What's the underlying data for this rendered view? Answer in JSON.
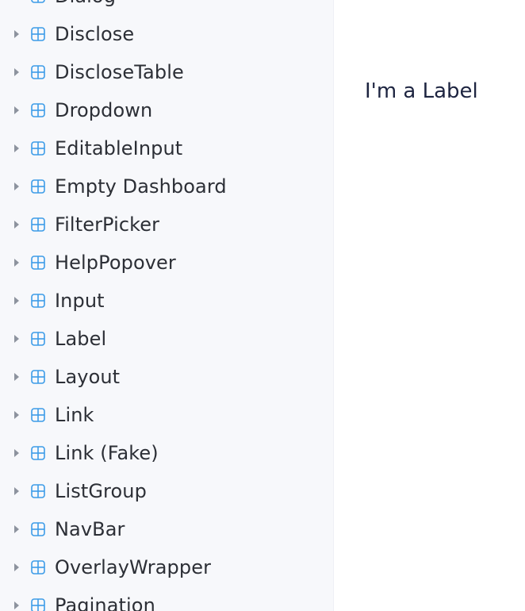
{
  "sidebar": {
    "items": [
      {
        "label": "Dialog"
      },
      {
        "label": "Disclose"
      },
      {
        "label": "DiscloseTable"
      },
      {
        "label": "Dropdown"
      },
      {
        "label": "EditableInput"
      },
      {
        "label": "Empty Dashboard"
      },
      {
        "label": "FilterPicker"
      },
      {
        "label": "HelpPopover"
      },
      {
        "label": "Input"
      },
      {
        "label": "Label"
      },
      {
        "label": "Layout"
      },
      {
        "label": "Link"
      },
      {
        "label": "Link (Fake)"
      },
      {
        "label": "ListGroup"
      },
      {
        "label": "NavBar"
      },
      {
        "label": "OverlayWrapper"
      },
      {
        "label": "Pagination"
      }
    ],
    "icons": {
      "expand": "caret-right-icon",
      "component": "component-grid-icon"
    }
  },
  "main": {
    "preview_text": "I'm a Label"
  },
  "colors": {
    "sidebar_bg": "#f7f8fb",
    "icon_accent": "#3d9ce8",
    "caret": "#8d939e",
    "item_text": "#2c2f36",
    "preview_text": "#1d2440"
  }
}
